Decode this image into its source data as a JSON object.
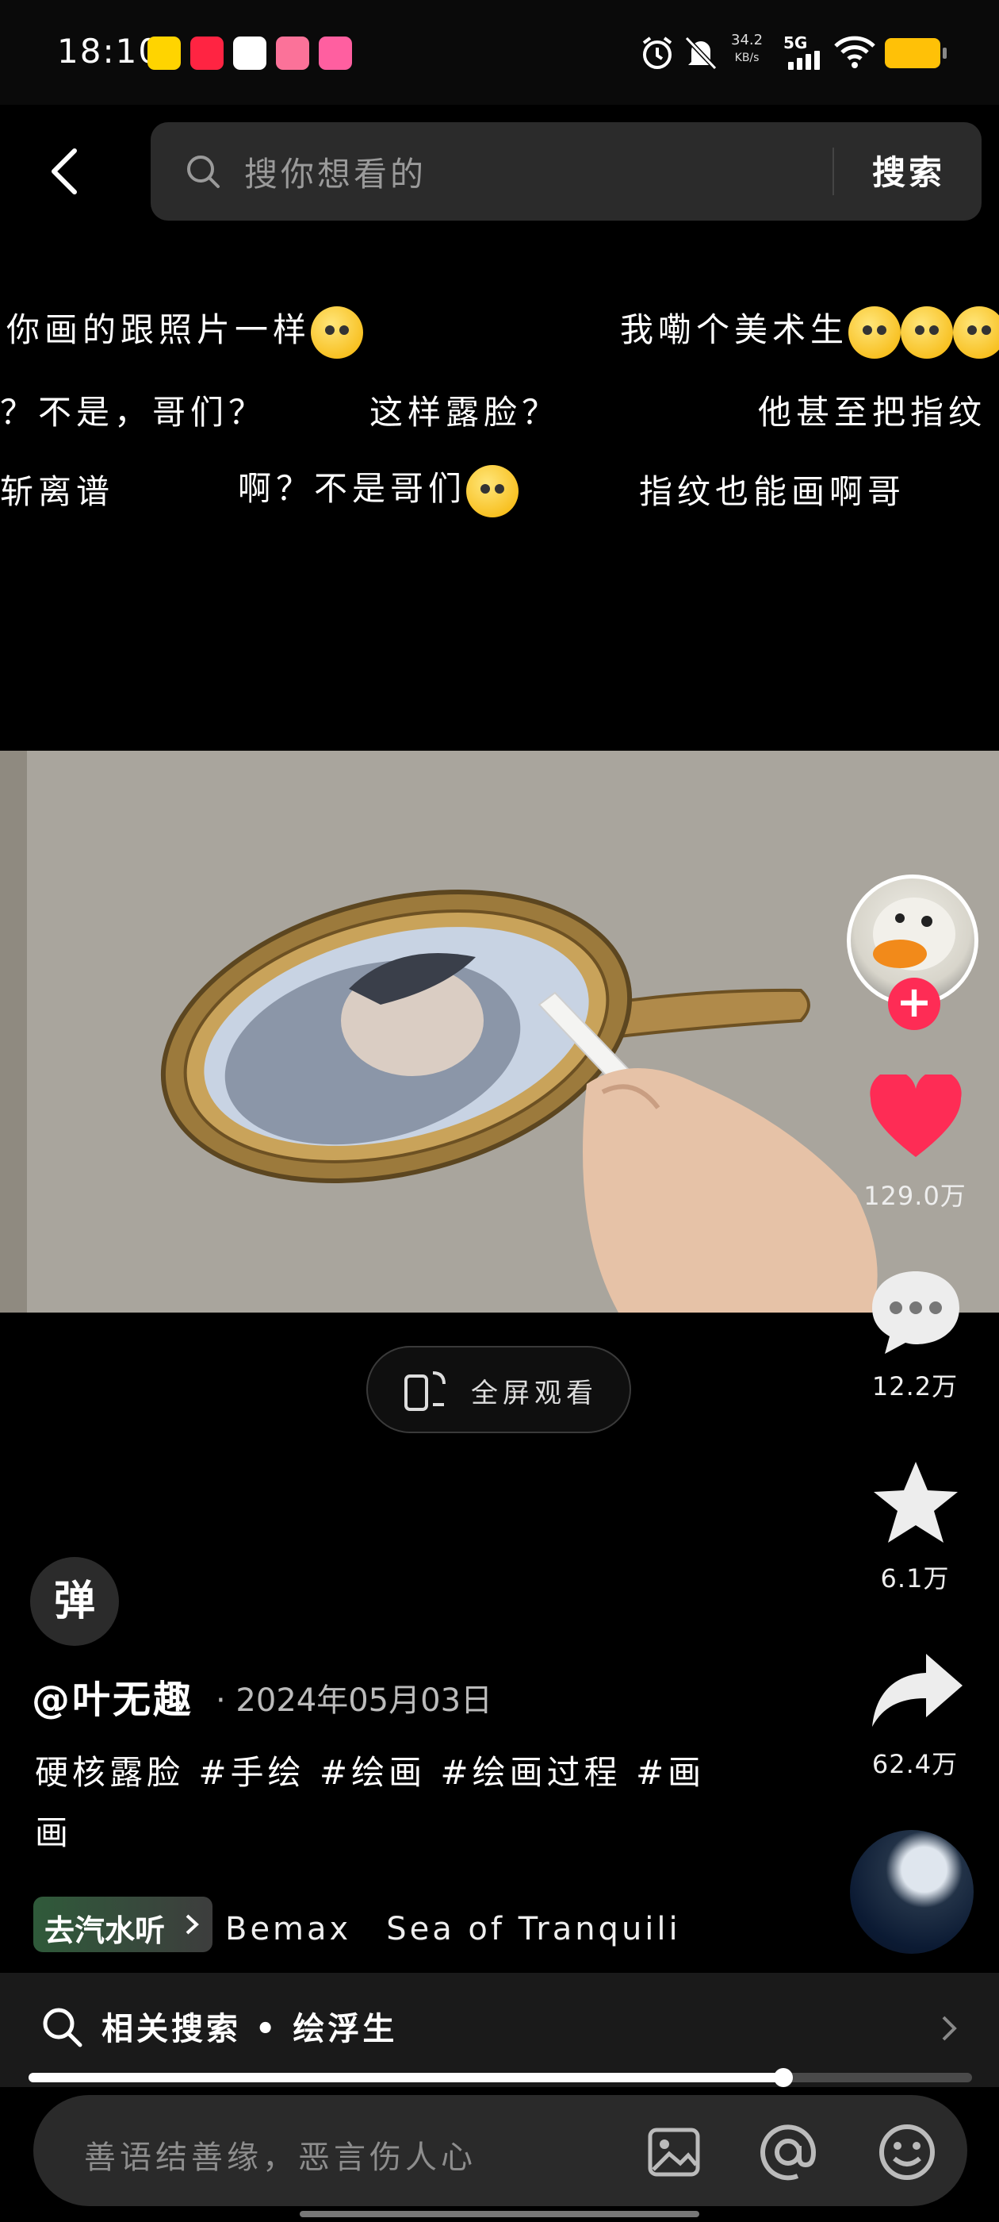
{
  "status_bar": {
    "time": "18:10",
    "net_speed_value": "34.2",
    "net_speed_unit": "KB/s",
    "network": "5G",
    "apps": [
      {
        "name": "app-1",
        "color": "#ffd400"
      },
      {
        "name": "小红书",
        "color": "#ff2442"
      },
      {
        "name": "app-3",
        "color": "#ffffff"
      },
      {
        "name": "bilibili",
        "color": "#fb7299"
      },
      {
        "name": "app-5",
        "color": "#ff5fa0"
      }
    ],
    "icons": [
      "alarm-icon",
      "mute-icon",
      "signal-icon",
      "wifi-icon",
      "battery-icon"
    ]
  },
  "search": {
    "placeholder": "搜你想看的",
    "button": "搜索"
  },
  "danmaku": [
    {
      "text": "你画的跟照片一样",
      "emoji": true
    },
    {
      "text": "我嘞个美术生",
      "emoji": true
    },
    {
      "text": "？不是，哥们？",
      "emoji": false
    },
    {
      "text": "这样露脸？",
      "emoji": false
    },
    {
      "text": "他甚至把指纹",
      "emoji": false
    },
    {
      "text": "斩离谱",
      "emoji": false
    },
    {
      "text": "啊？不是哥们",
      "emoji": true
    },
    {
      "text": "指纹也能画啊哥",
      "emoji": false
    }
  ],
  "actions": {
    "likes": "129.0万",
    "comments": "12.2万",
    "favorites": "6.1万",
    "shares": "62.4万"
  },
  "fullscreen_label": "全屏观看",
  "danmaku_toggle": "弹",
  "post": {
    "author": "@叶无趣",
    "date": "· 2024年05月03日",
    "description": "硬核露脸 #手绘 #绘画 #绘画过程 #画画"
  },
  "music": {
    "chip": "去汽水听",
    "track": "Bemax　Sea of Tranquili"
  },
  "related_search": "相关搜索 • 绘浮生",
  "playback_progress": 0.8,
  "comment_placeholder": "善语结善缘，恶言伤人心",
  "colors": {
    "like": "#fe2c55",
    "follow": "#fe2c55",
    "battery": "#ffc107",
    "music_chip": "#2f5a3a"
  }
}
